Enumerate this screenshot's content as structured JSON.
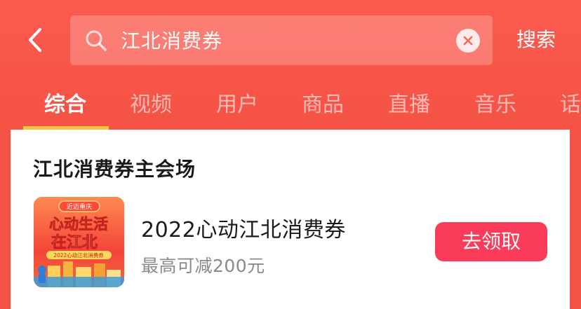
{
  "search": {
    "query": "江北消费券",
    "button_label": "搜索"
  },
  "tabs": [
    {
      "label": "综合",
      "active": true
    },
    {
      "label": "视频",
      "active": false
    },
    {
      "label": "用户",
      "active": false
    },
    {
      "label": "商品",
      "active": false
    },
    {
      "label": "直播",
      "active": false
    },
    {
      "label": "音乐",
      "active": false
    },
    {
      "label": "话",
      "active": false
    }
  ],
  "card": {
    "section_title": "江北消费券主会场",
    "item_title": "2022心动江北消费券",
    "item_subtitle": "最高可减200元",
    "claim_label": "去领取",
    "thumbnail": {
      "badge": "近迈重庆",
      "headline_line1": "心动生活",
      "headline_line2": "在江北",
      "footer": "2022心动江北消费券"
    }
  },
  "colors": {
    "header_bg": "#f65246",
    "tab_indicator": "#f8c33d",
    "claim_button": "#fb3b5a"
  },
  "icons": {
    "back": "chevron-left-icon",
    "search": "search-icon",
    "clear": "clear-icon"
  }
}
